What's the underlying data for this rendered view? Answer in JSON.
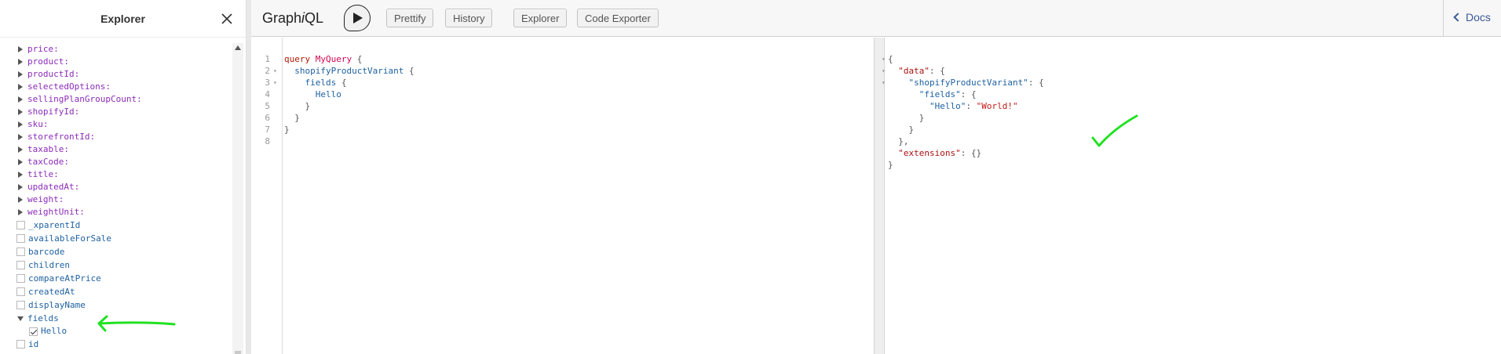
{
  "explorer": {
    "title": "Explorer",
    "expandable_fields": [
      "price:",
      "product:",
      "productId:",
      "selectedOptions:",
      "sellingPlanGroupCount:",
      "shopifyId:",
      "sku:",
      "storefrontId:",
      "taxable:",
      "taxCode:",
      "title:",
      "updatedAt:",
      "weight:",
      "weightUnit:"
    ],
    "checkbox_fields": [
      "_xparentId",
      "availableForSale",
      "barcode",
      "children",
      "compareAtPrice",
      "createdAt",
      "displayName"
    ],
    "expanded_field": "fields",
    "subfield": "Hello",
    "subfield_checked": true,
    "last_field": "id"
  },
  "toolbar": {
    "logo_pre": "Graph",
    "logo_i": "i",
    "logo_post": "QL",
    "prettify": "Prettify",
    "history": "History",
    "explorer": "Explorer",
    "code_exporter": "Code Exporter",
    "docs": "Docs"
  },
  "editor": {
    "line_numbers": [
      "1",
      "2",
      "3",
      "4",
      "5",
      "6",
      "7",
      "8"
    ],
    "query_keyword": "query",
    "query_name": "MyQuery",
    "brace_open": "{",
    "field_1": "shopifyProductVariant",
    "field_2": "fields",
    "field_3": "Hello",
    "brace_close": "}"
  },
  "result": {
    "data_key": "\"data\"",
    "variant_key": "\"shopifyProductVariant\"",
    "fields_key": "\"fields\"",
    "hello_key": "\"Hello\"",
    "hello_value": "\"World!\"",
    "extensions_key": "\"extensions\"",
    "empty_obj": "{}"
  },
  "annotations": {
    "color": "#22e122"
  }
}
